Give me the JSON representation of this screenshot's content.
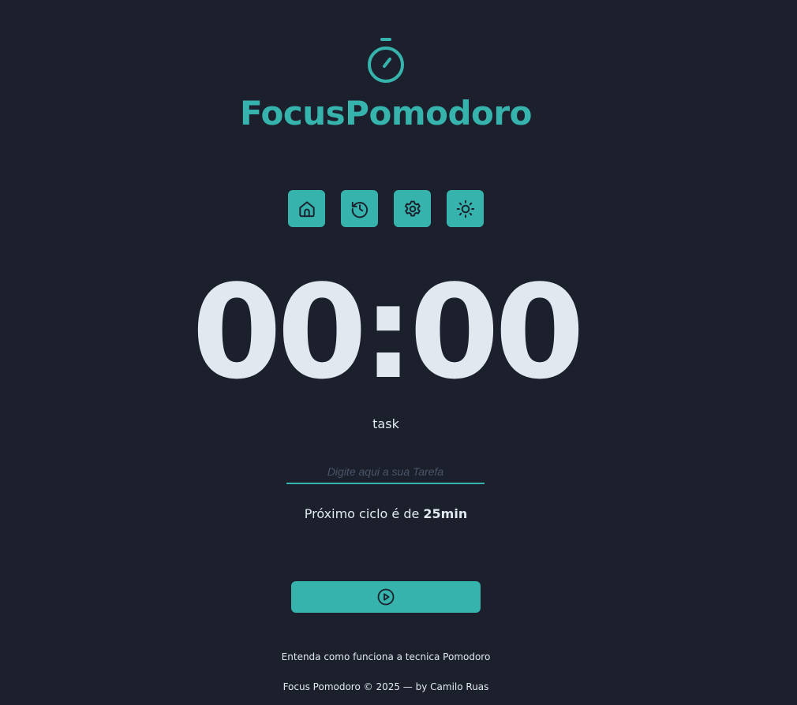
{
  "app": {
    "title": "FocusPomodoro",
    "accent_color": "#36b3ac",
    "background_color": "#1b202c"
  },
  "menu": [
    {
      "icon": "home-icon",
      "label": ""
    },
    {
      "icon": "history-icon",
      "label": ""
    },
    {
      "icon": "gear-icon",
      "label": ""
    },
    {
      "icon": "sun-icon",
      "label": ""
    }
  ],
  "timer": {
    "display": "00:00"
  },
  "task": {
    "label": "task",
    "input_value": "",
    "placeholder": "Digite aqui a sua Tarefa"
  },
  "cycle": {
    "prefix": "Próximo ciclo é de ",
    "duration": "25min"
  },
  "play_button": {
    "icon": "play-circle-icon"
  },
  "footer": {
    "link_text": "Entenda como funciona a tecnica Pomodoro",
    "copyright": "Focus Pomodoro © 2025 — by Camilo Ruas"
  }
}
